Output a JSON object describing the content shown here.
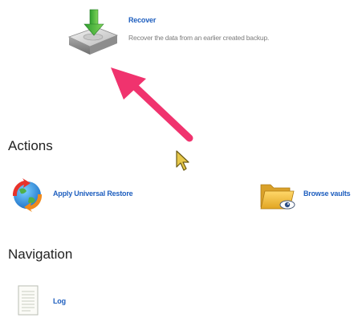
{
  "recover": {
    "title": "Recover",
    "description": "Recover the data from an earlier created backup."
  },
  "actions": {
    "heading": "Actions",
    "items": [
      {
        "label": "Apply Universal Restore",
        "icon": "universal-restore-icon"
      },
      {
        "label": "Browse vaults",
        "icon": "folder-eye-icon"
      }
    ]
  },
  "navigation": {
    "heading": "Navigation",
    "items": [
      {
        "label": "Log",
        "icon": "document-icon"
      }
    ]
  },
  "colors": {
    "link": "#1f5fbf",
    "annotation_arrow": "#f0336e"
  }
}
